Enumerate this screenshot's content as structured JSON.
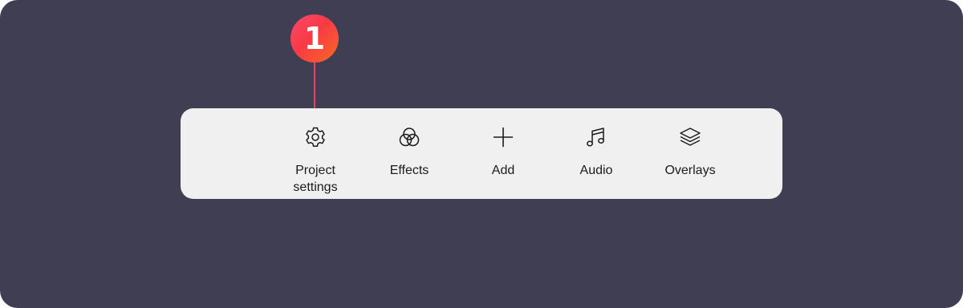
{
  "callout": {
    "number": "1",
    "color": "#f73a45"
  },
  "toolbar": {
    "items": [
      {
        "id": "project-settings",
        "label": "Project\nsettings",
        "icon": "gear-icon"
      },
      {
        "id": "effects",
        "label": "Effects",
        "icon": "effects-circles-icon"
      },
      {
        "id": "add",
        "label": "Add",
        "icon": "plus-icon"
      },
      {
        "id": "audio",
        "label": "Audio",
        "icon": "music-note-icon"
      },
      {
        "id": "overlays",
        "label": "Overlays",
        "icon": "layers-icon"
      }
    ]
  },
  "colors": {
    "background": "#3f3e53",
    "toolbar": "#f0f0f0",
    "text": "#1b1b1b"
  }
}
